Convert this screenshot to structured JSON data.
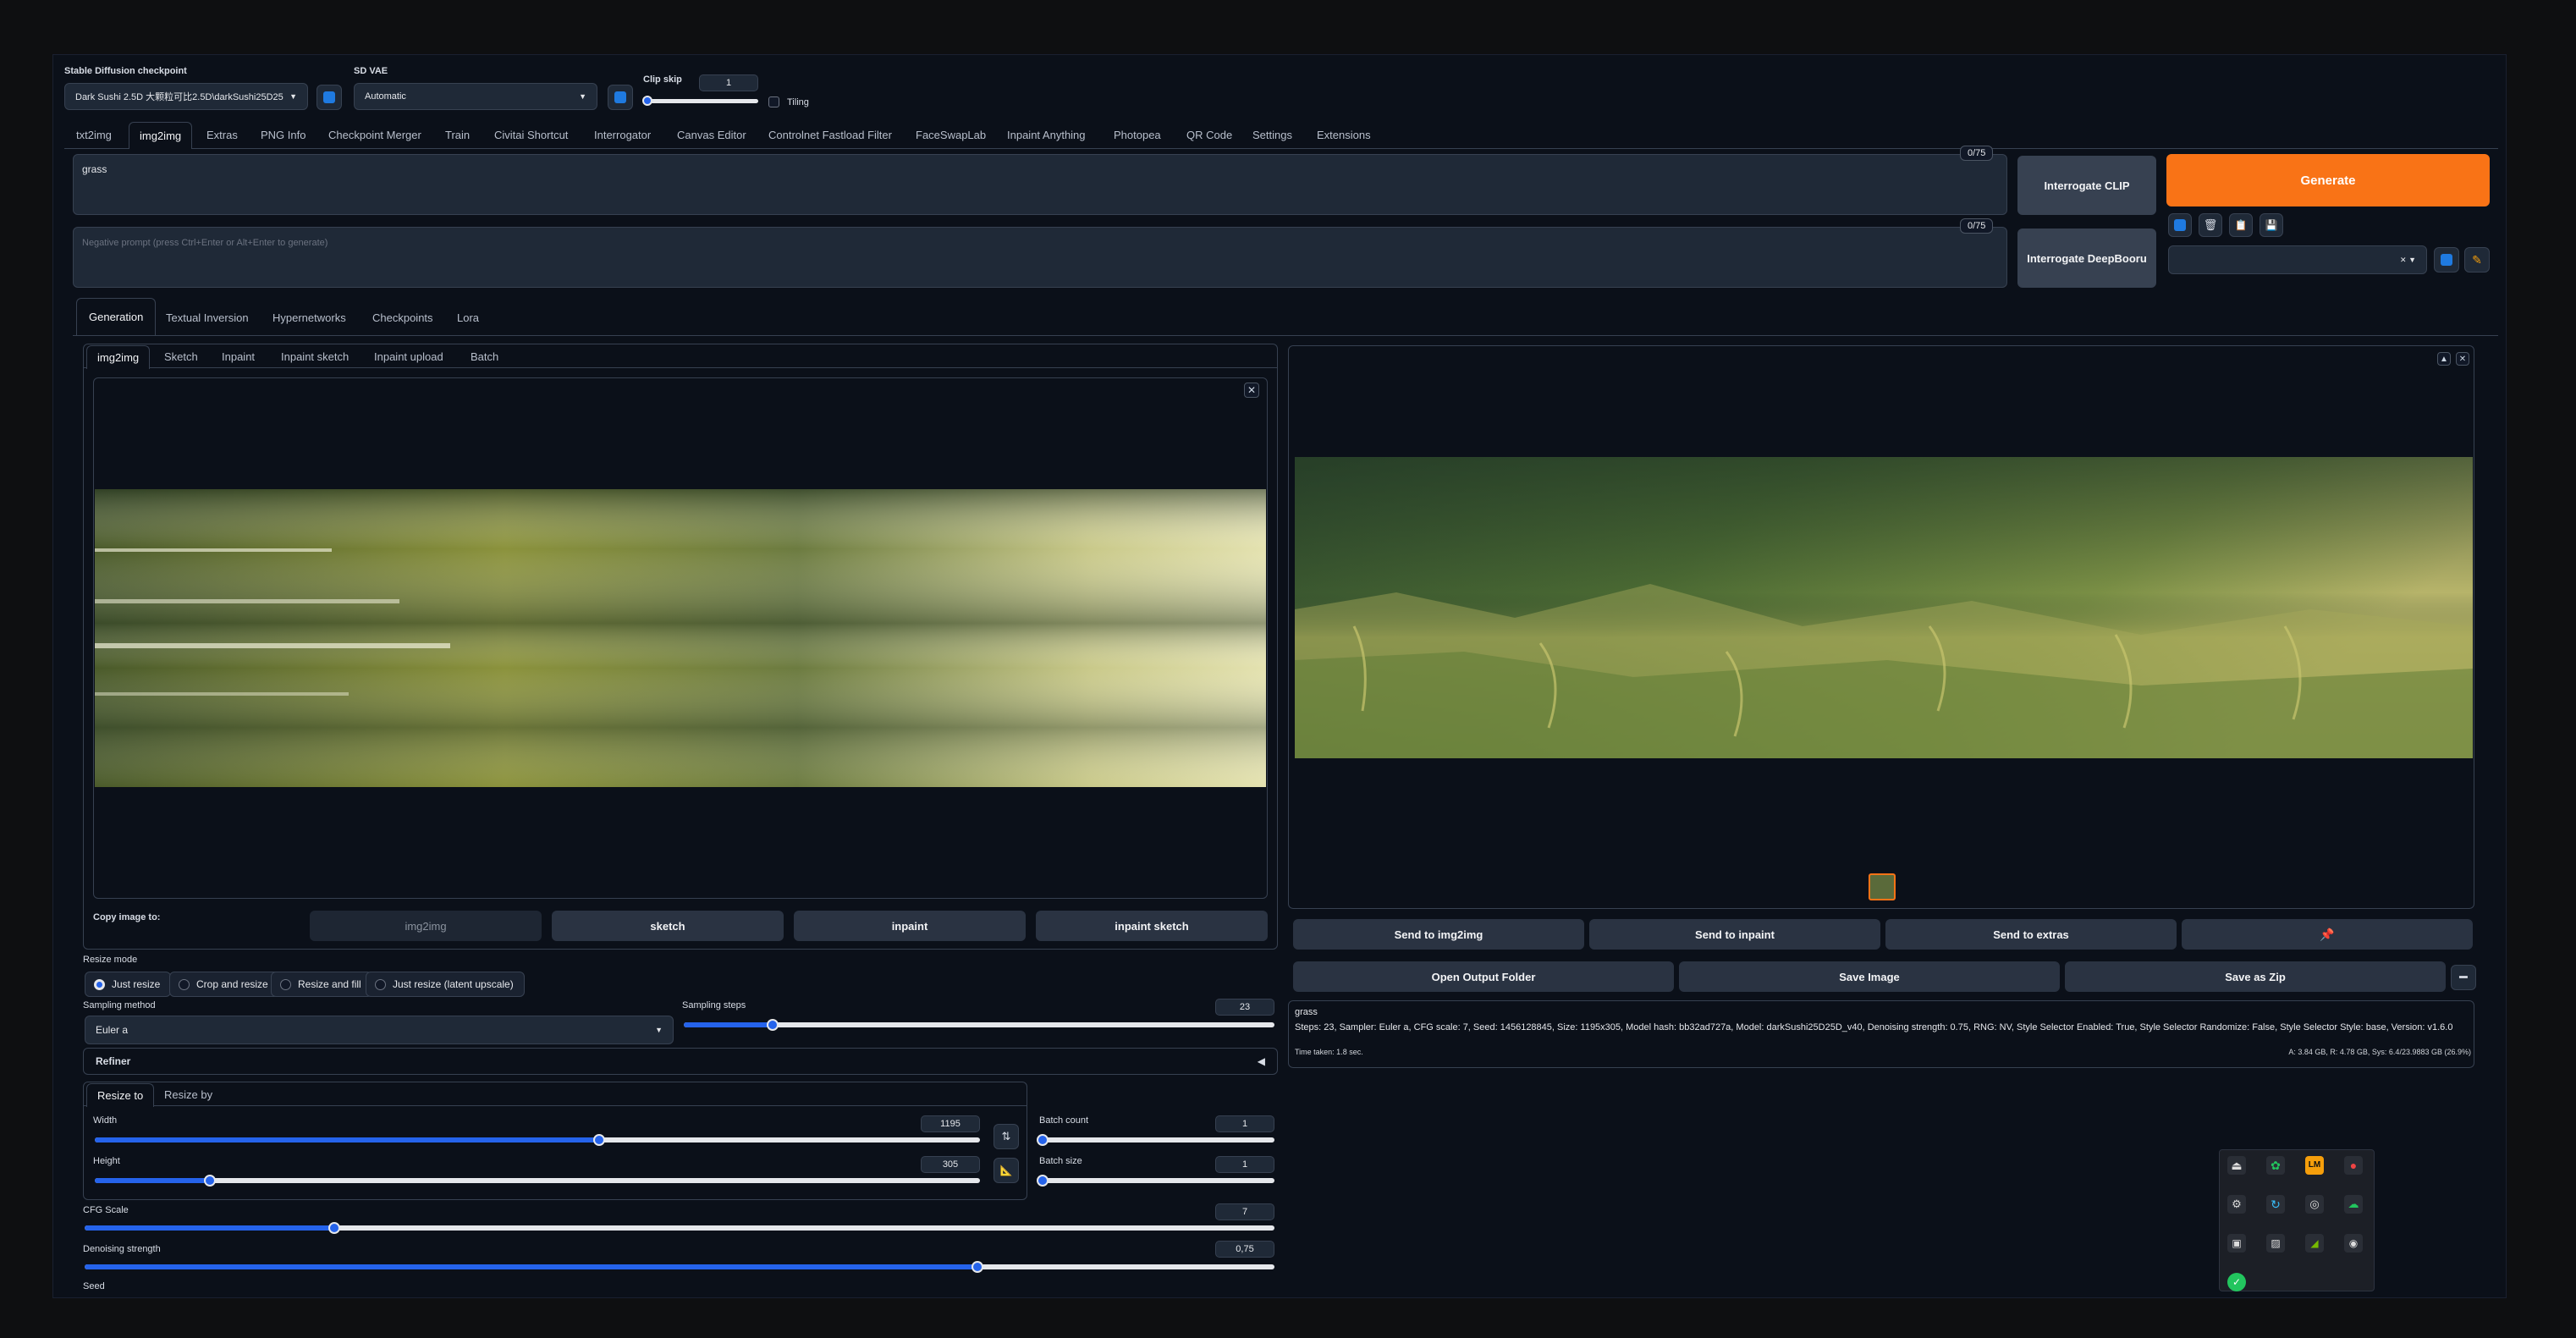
{
  "header": {
    "checkpoint_label": "Stable Diffusion checkpoint",
    "checkpoint_value": "Dark Sushi 2.5D 大颗粒可比2.5D\\darkSushi25D25",
    "vae_label": "SD VAE",
    "vae_value": "Automatic",
    "clip_skip_label": "Clip skip",
    "clip_skip_value": "1",
    "tiling_label": "Tiling"
  },
  "main_tabs": [
    "txt2img",
    "img2img",
    "Extras",
    "PNG Info",
    "Checkpoint Merger",
    "Train",
    "Civitai Shortcut",
    "Interrogator",
    "Canvas Editor",
    "Controlnet Fastload Filter",
    "FaceSwapLab",
    "Inpaint Anything",
    "Photopea",
    "QR Code",
    "Settings",
    "Extensions"
  ],
  "active_main_tab": "img2img",
  "prompt": {
    "value": "grass",
    "counter": "0/75",
    "negative_placeholder": "Negative prompt (press Ctrl+Enter or Alt+Enter to generate)",
    "negative_counter": "0/75"
  },
  "buttons": {
    "interrogate_clip": "Interrogate CLIP",
    "interrogate_deepbooru": "Interrogate DeepBooru",
    "generate": "Generate"
  },
  "sub_tabs": [
    "Generation",
    "Textual Inversion",
    "Hypernetworks",
    "Checkpoints",
    "Lora"
  ],
  "mode_tabs": [
    "img2img",
    "Sketch",
    "Inpaint",
    "Inpaint sketch",
    "Inpaint upload",
    "Batch"
  ],
  "copy_image": {
    "label": "Copy image to:",
    "buttons": [
      "img2img",
      "sketch",
      "inpaint",
      "inpaint sketch"
    ]
  },
  "resize_mode": {
    "label": "Resize mode",
    "options": [
      "Just resize",
      "Crop and resize",
      "Resize and fill",
      "Just resize (latent upscale)"
    ],
    "selected": "Just resize"
  },
  "sampling": {
    "method_label": "Sampling method",
    "method_value": "Euler a",
    "steps_label": "Sampling steps",
    "steps_value": "23",
    "steps_fraction": 0.15
  },
  "refiner_label": "Refiner",
  "resize_tabs": [
    "Resize to",
    "Resize by"
  ],
  "dims": {
    "width_label": "Width",
    "width_value": "1195",
    "width_fraction": 0.57,
    "height_label": "Height",
    "height_value": "305",
    "height_fraction": 0.13,
    "batch_count_label": "Batch count",
    "batch_count_value": "1",
    "batch_size_label": "Batch size",
    "batch_size_value": "1"
  },
  "cfg": {
    "label": "CFG Scale",
    "value": "7",
    "fraction": 0.21
  },
  "denoise": {
    "label": "Denoising strength",
    "value": "0,75",
    "fraction": 0.75
  },
  "seed_label": "Seed",
  "output": {
    "send_buttons": [
      "Send to img2img",
      "Send to inpaint",
      "Send to extras"
    ],
    "folder_buttons": [
      "Open Output Folder",
      "Save Image",
      "Save as Zip"
    ],
    "caption": "grass",
    "info": "Steps: 23, Sampler: Euler a, CFG scale: 7, Seed: 1456128845, Size: 1195x305, Model hash: bb32ad727a, Model: darkSushi25D25D_v40, Denoising strength: 0.75, RNG: NV, Style Selector Enabled: True, Style Selector Randomize: False, Style Selector Style: base, Version: v1.6.0",
    "time_taken": "Time taken: 1.8 sec.",
    "vram": "A: 3.84 GB, R: 4.78 GB, Sys: 6.4/23.9883 GB (26.9%)"
  },
  "colors": {
    "accent": "#f97316",
    "slider": "#2563eb",
    "panel": "#1f2937"
  }
}
